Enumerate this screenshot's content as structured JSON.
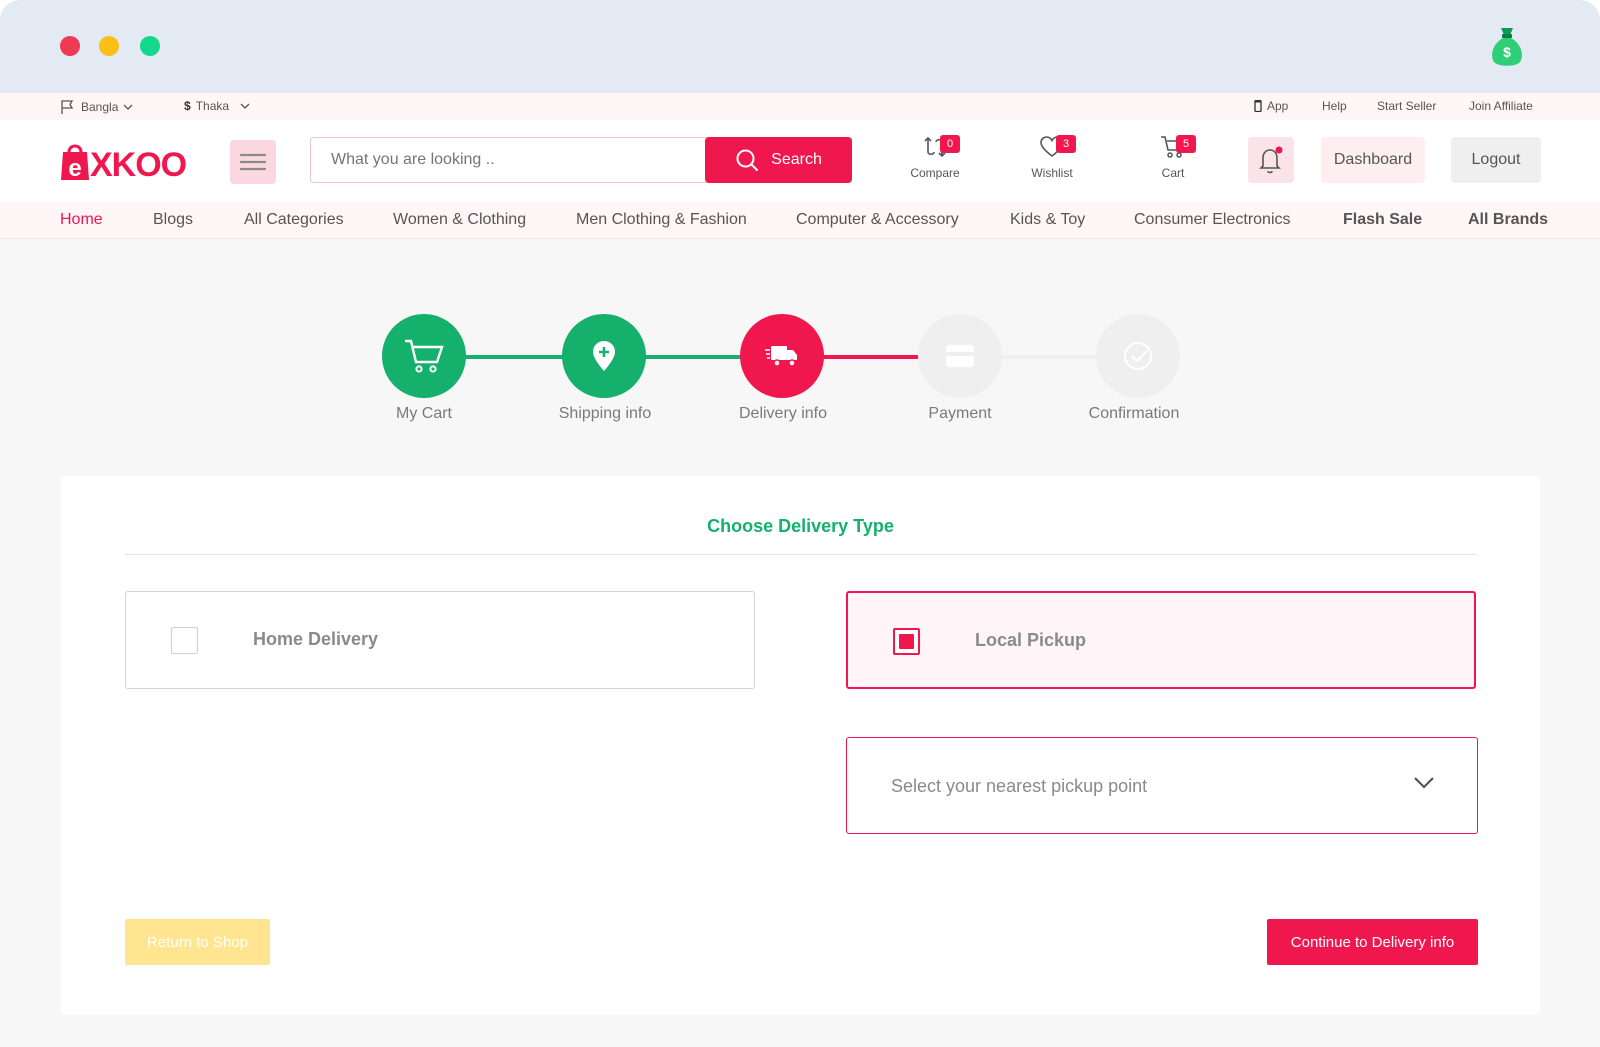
{
  "topbar": {
    "language": "Bangla",
    "currency_symbol": "$",
    "currency": "Thaka",
    "links": [
      "App",
      "Help",
      "Start Seller",
      "Join Affiliate"
    ]
  },
  "header": {
    "logo": "exkoo",
    "search_placeholder": "What you are looking ..",
    "search_button": "Search",
    "compare": {
      "label": "Compare",
      "count": "0"
    },
    "wishlist": {
      "label": "Wishlist",
      "count": "3"
    },
    "cart": {
      "label": "Cart",
      "count": "5"
    },
    "dashboard": "Dashboard",
    "logout": "Logout"
  },
  "nav": [
    "Home",
    "Blogs",
    "All Categories",
    "Women & Clothing",
    "Men Clothing & Fashion",
    "Computer & Accessory",
    "Kids & Toy",
    "Consumer Electronics",
    "Flash Sale",
    "All Brands"
  ],
  "steps": [
    {
      "label": "My Cart",
      "state": "done"
    },
    {
      "label": "Shipping info",
      "state": "done"
    },
    {
      "label": "Delivery info",
      "state": "current"
    },
    {
      "label": "Payment",
      "state": "pending"
    },
    {
      "label": "Confirmation",
      "state": "pending"
    }
  ],
  "delivery": {
    "title": "Choose Delivery Type",
    "home_delivery": "Home Delivery",
    "local_pickup": "Local Pickup",
    "selected": "Local Pickup",
    "pickup_placeholder": "Select your nearest pickup point"
  },
  "actions": {
    "return": "Return to Shop",
    "continue": "Continue to Delivery info"
  },
  "colors": {
    "brand": "#f0174f",
    "done": "#14b06c",
    "pending": "#efefef"
  }
}
